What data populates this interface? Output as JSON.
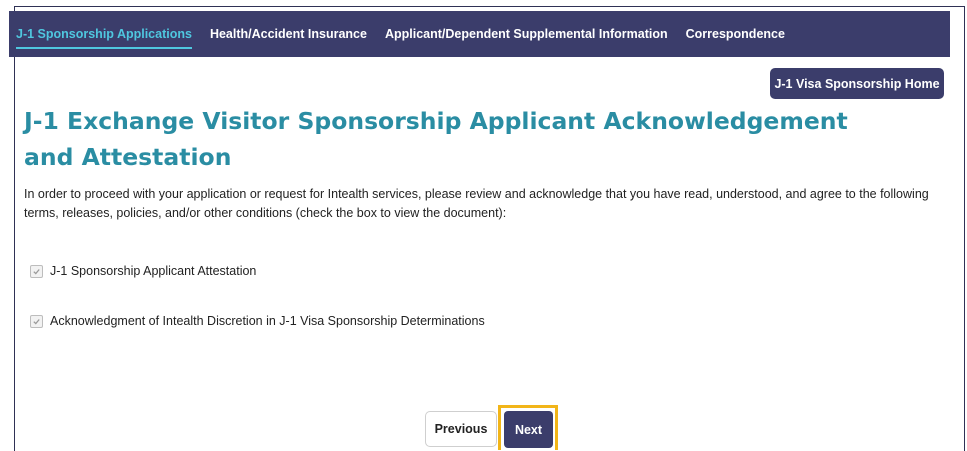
{
  "nav": {
    "tabs": [
      {
        "label": "J-1 Sponsorship Applications",
        "active": true
      },
      {
        "label": "Health/Accident Insurance",
        "active": false
      },
      {
        "label": "Applicant/Dependent Supplemental Information",
        "active": false
      },
      {
        "label": "Correspondence",
        "active": false
      }
    ]
  },
  "header": {
    "home_button_label": "J-1 Visa Sponsorship Home"
  },
  "page": {
    "title": "J-1 Exchange Visitor Sponsorship Applicant Acknowledgement and Attestation",
    "intro": "In order to proceed with your application or request for Intealth services, please review and acknowledge that you have read, understood, and agree to the following terms, releases, policies, and/or other conditions (check the box to view the document):"
  },
  "checklist": [
    {
      "label": "J-1 Sponsorship Applicant Attestation",
      "checked": true
    },
    {
      "label": "Acknowledgment of Intealth Discretion in J-1 Visa Sponsorship Determinations",
      "checked": true
    }
  ],
  "footer": {
    "previous_label": "Previous",
    "next_label": "Next"
  },
  "colors": {
    "nav_bg": "#3b3d6b",
    "accent": "#4fc7df",
    "title": "#2a8da3",
    "highlight": "#f2b518"
  }
}
